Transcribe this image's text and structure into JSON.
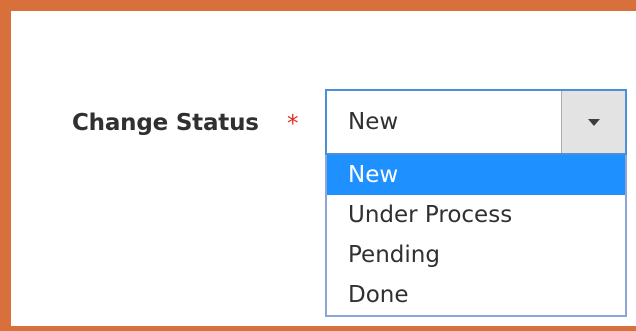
{
  "form": {
    "label": "Change Status",
    "required_mark": "*",
    "selected_value": "New",
    "options": [
      {
        "label": "New",
        "highlighted": true
      },
      {
        "label": "Under Process",
        "highlighted": false
      },
      {
        "label": "Pending",
        "highlighted": false
      },
      {
        "label": "Done",
        "highlighted": false
      }
    ]
  },
  "colors": {
    "frame_border": "#d8703c",
    "select_focus_border": "#4a90d9",
    "option_highlight": "#1e90ff",
    "required_mark": "#e02b27"
  },
  "icons": {
    "dropdown_arrow": "chevron-down-icon"
  }
}
